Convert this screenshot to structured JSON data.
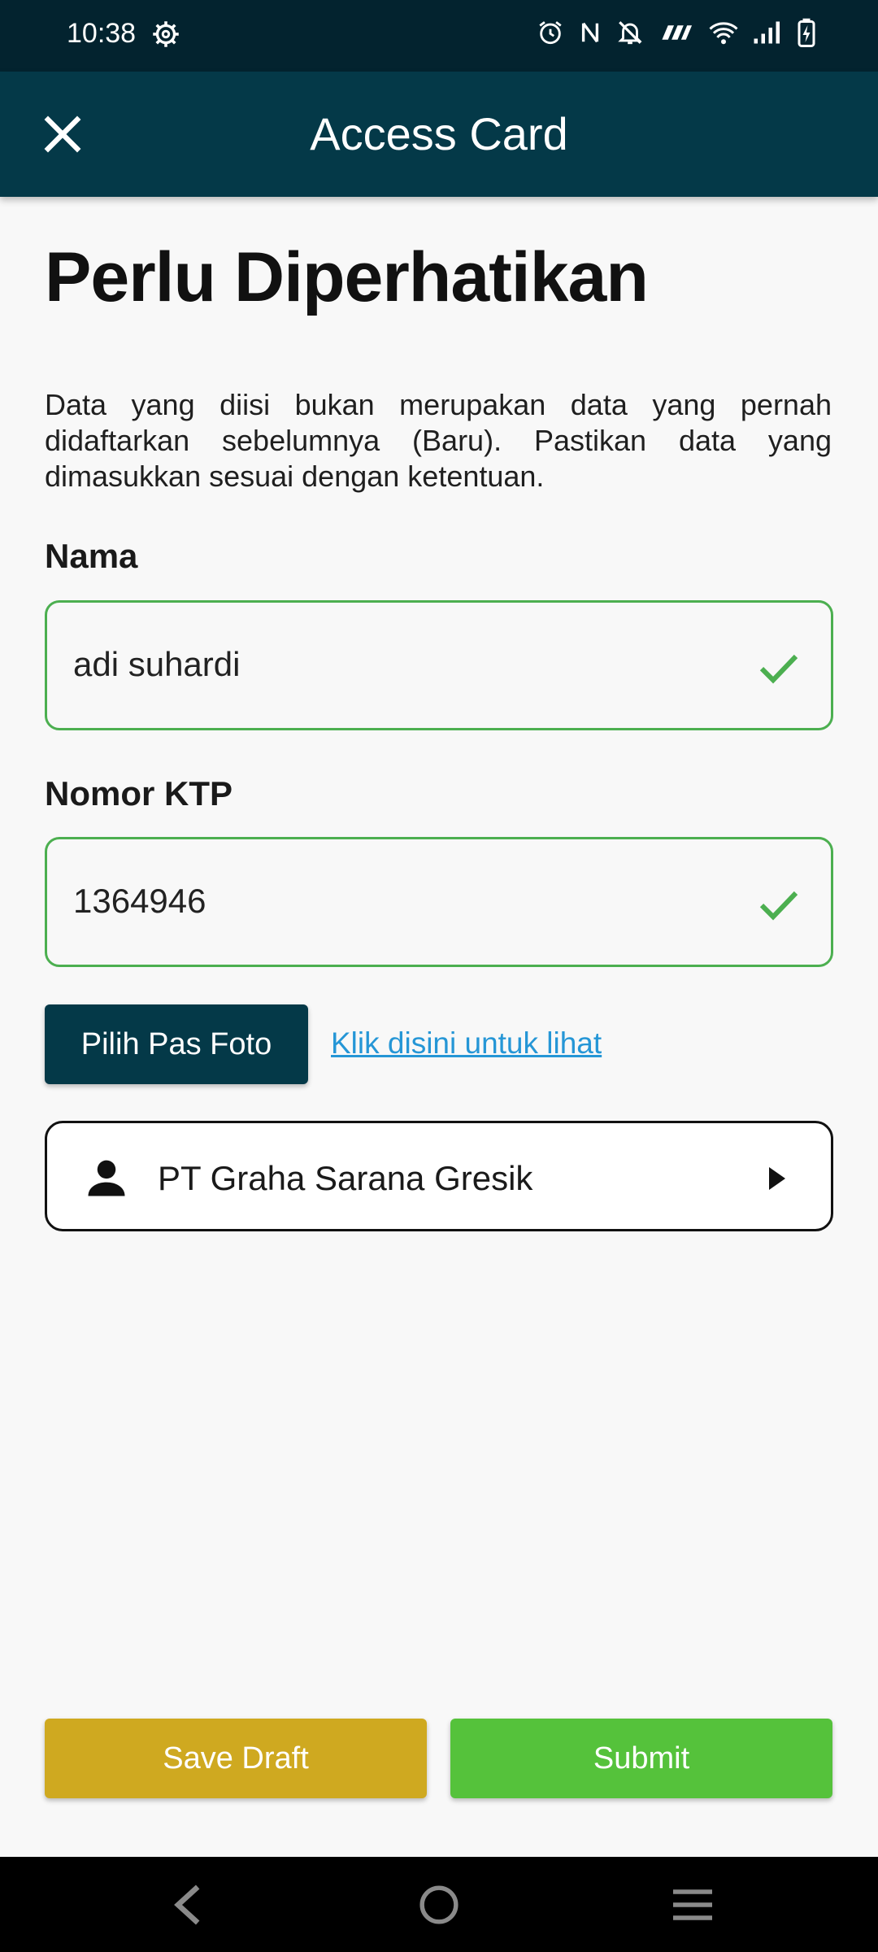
{
  "status_bar": {
    "time": "10:38"
  },
  "app_bar": {
    "title": "Access Card",
    "close_icon": "close-icon"
  },
  "page": {
    "title": "Perlu Diperhatikan",
    "intro": "Data yang diisi bukan merupakan data yang pernah didaftarkan sebelumnya (Baru). Pastikan data yang dimasukkan sesuai dengan ketentuan."
  },
  "form": {
    "nama": {
      "label": "Nama",
      "value": "adi suhardi"
    },
    "ktp": {
      "label": "Nomor KTP",
      "value": "1364946"
    },
    "photo_button": "Pilih Pas Foto",
    "view_link": "Klik disini untuk lihat",
    "company": "PT Graha Sarana Gresik"
  },
  "actions": {
    "save_draft": "Save Draft",
    "submit": "Submit"
  },
  "colors": {
    "status_bar": "#03232f",
    "app_bar": "#043948",
    "valid_border": "#4caf50",
    "link": "#2596d6",
    "save_draft": "#cfa920",
    "submit": "#55c23b"
  }
}
